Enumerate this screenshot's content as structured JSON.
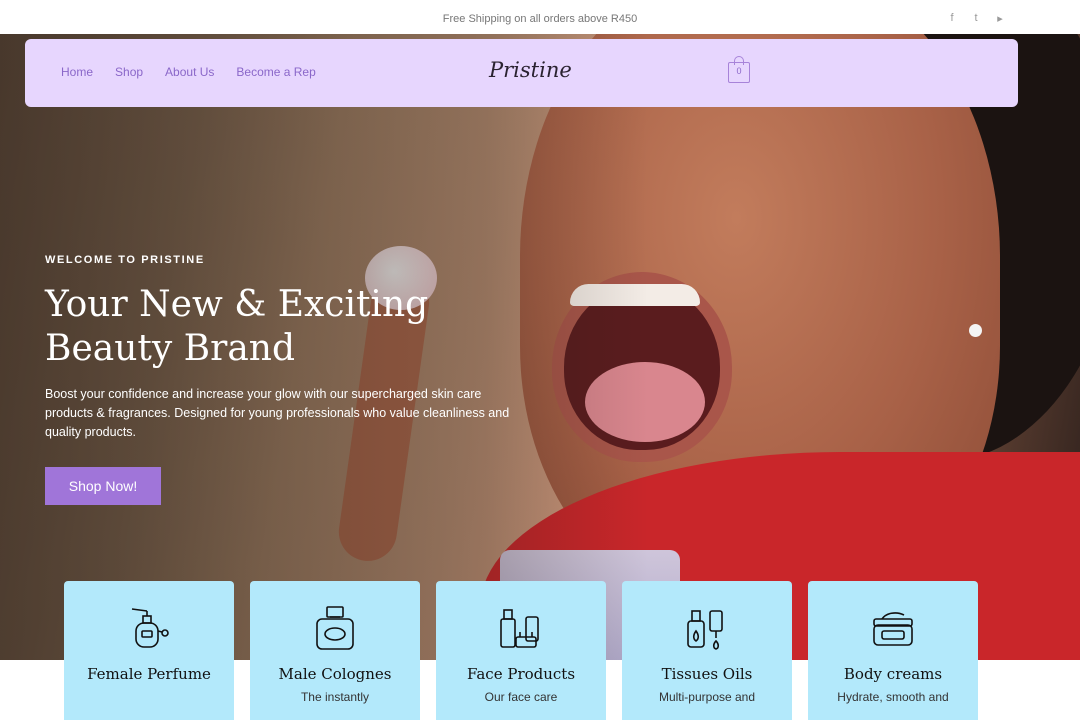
{
  "topbar": {
    "shipping": "Free Shipping on all orders above R450",
    "social": [
      {
        "icon": "facebook-icon",
        "glyph": "f"
      },
      {
        "icon": "twitter-icon",
        "glyph": "t"
      },
      {
        "icon": "youtube-icon",
        "glyph": "▸"
      }
    ]
  },
  "nav": {
    "links": [
      "Home",
      "Shop",
      "About Us",
      "Become a Rep"
    ],
    "logo": "Pristine",
    "cart_count": "0"
  },
  "hero": {
    "eyebrow": "WELCOME TO PRISTINE",
    "title": "Your New & Exciting Beauty Brand",
    "description": "Boost your confidence and increase your glow with our supercharged skin care products & fragrances. Designed for young professionals who value cleanliness and quality products.",
    "cta": "Shop Now!"
  },
  "categories": [
    {
      "title": "Female Perfume",
      "subtitle": "",
      "icon": "perfume-bottle-icon"
    },
    {
      "title": "Male Colognes",
      "subtitle": "The instantly",
      "icon": "cologne-bottle-icon"
    },
    {
      "title": "Face Products",
      "subtitle": "Our face care",
      "icon": "face-products-icon"
    },
    {
      "title": "Tissues Oils",
      "subtitle": "Multi-purpose and",
      "icon": "dropper-bottle-icon"
    },
    {
      "title": "Body creams",
      "subtitle": "Hydrate, smooth and",
      "icon": "cream-jar-icon"
    }
  ],
  "colors": {
    "nav_bg": "#e7d6fe",
    "accent": "#a075d9",
    "card_bg": "#b3e9fb"
  }
}
